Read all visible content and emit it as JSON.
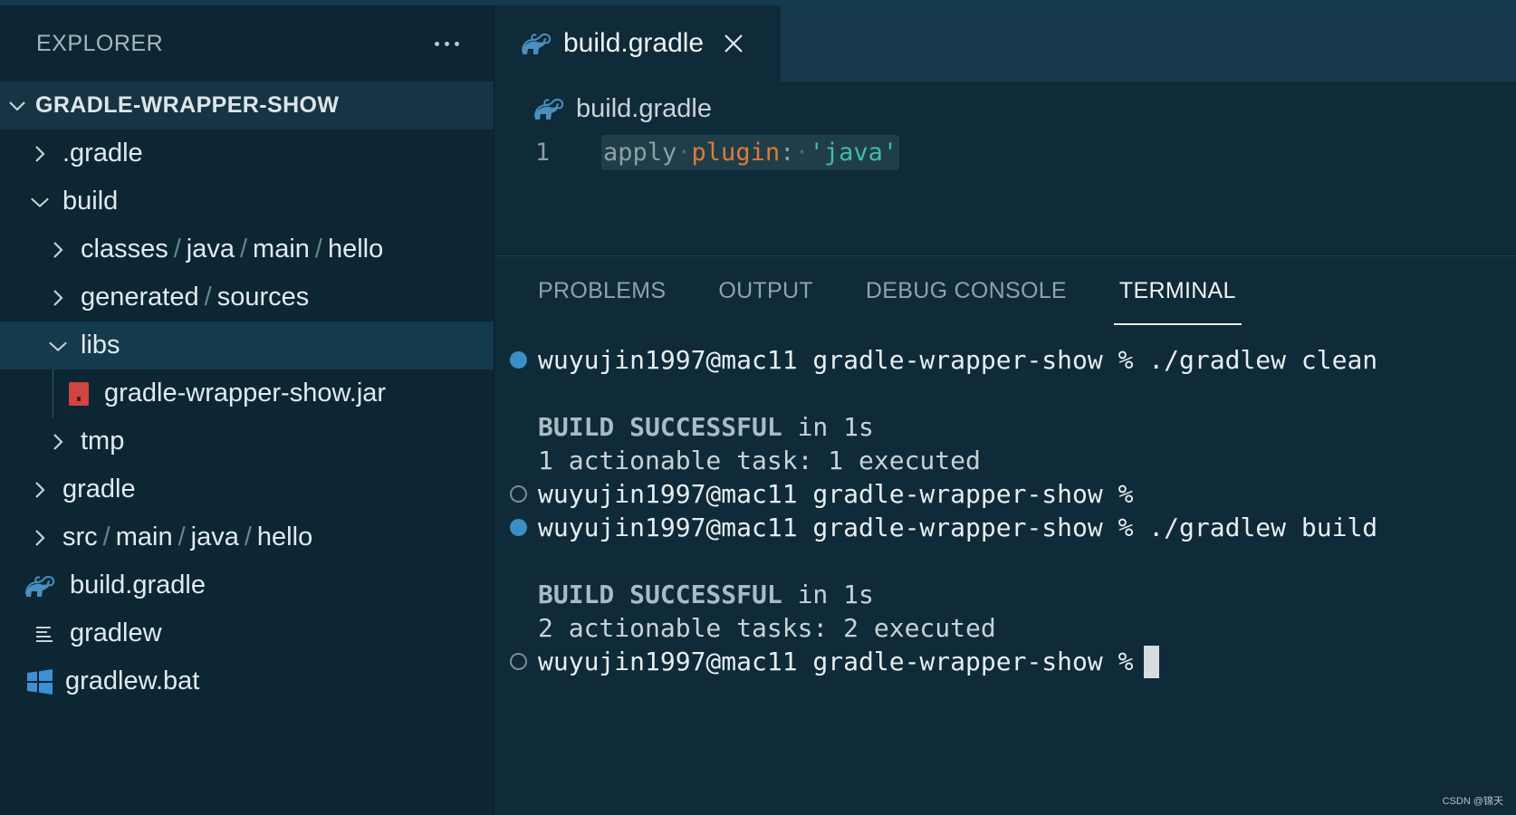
{
  "sidebar": {
    "title": "EXPLORER",
    "more_icon": "ellipsis-icon",
    "section_title": "GRADLE-WRAPPER-SHOW",
    "tree": {
      "gradle_dir": ".gradle",
      "build": "build",
      "classes_path": [
        "classes",
        "java",
        "main",
        "hello"
      ],
      "generated_path": [
        "generated",
        "sources"
      ],
      "libs": "libs",
      "jar": "gradle-wrapper-show.jar",
      "tmp": "tmp",
      "gradle": "gradle",
      "src_path": [
        "src",
        "main",
        "java",
        "hello"
      ],
      "build_gradle": "build.gradle",
      "gradlew": "gradlew",
      "gradlew_bat": "gradlew.bat",
      "separator": "/"
    }
  },
  "editor": {
    "tab_label": "build.gradle",
    "breadcrumb": "build.gradle",
    "line_number": "1",
    "code": {
      "kw": "apply",
      "dot1": "·",
      "prop": "plugin",
      "colon": ":",
      "dot2": "·",
      "str": "'java'"
    }
  },
  "panel": {
    "tabs": [
      "PROBLEMS",
      "OUTPUT",
      "DEBUG CONSOLE",
      "TERMINAL"
    ],
    "active_tab": "TERMINAL"
  },
  "terminal": {
    "prompt1": "wuyujin1997@mac11 gradle-wrapper-show % ./gradlew clean",
    "build_success_1a": "BUILD SUCCESSFUL",
    "build_success_1b": " in 1s",
    "tasks_1": "1 actionable task: 1 executed",
    "prompt2": "wuyujin1997@mac11 gradle-wrapper-show %",
    "prompt3": "wuyujin1997@mac11 gradle-wrapper-show % ./gradlew build",
    "build_success_2a": "BUILD SUCCESSFUL",
    "build_success_2b": " in 1s",
    "tasks_2": "2 actionable tasks: 2 executed",
    "prompt4": "wuyujin1997@mac11 gradle-wrapper-show %"
  },
  "watermark": "CSDN @锦天",
  "colors": {
    "accent_blue": "#3b8fc4",
    "gradle_icon": "#4a8fbf",
    "jar_icon": "#d0453f",
    "windows_icon": "#3e8fd4"
  }
}
